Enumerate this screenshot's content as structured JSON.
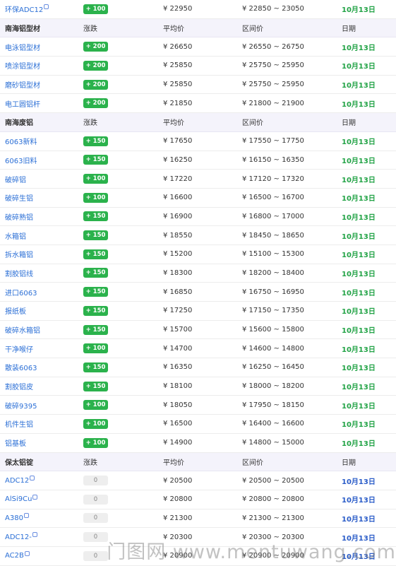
{
  "sections": [
    {
      "header": null,
      "rows": [
        {
          "name": "环保ADC12",
          "tag": true,
          "change": "+ 100",
          "change_type": "up",
          "avg": "¥ 22950",
          "range": "¥ 22850 ~ 23050",
          "date": "10月13日",
          "date_color": "green"
        }
      ]
    },
    {
      "header": {
        "name": "南海铝型材",
        "change": "涨跌",
        "avg": "平均价",
        "range": "区间价",
        "date": "日期"
      },
      "rows": [
        {
          "name": "电泳铝型材",
          "change": "+ 200",
          "change_type": "up",
          "avg": "¥ 26650",
          "range": "¥ 26550 ~ 26750",
          "date": "10月13日",
          "date_color": "green"
        },
        {
          "name": "喷涂铝型材",
          "change": "+ 200",
          "change_type": "up",
          "avg": "¥ 25850",
          "range": "¥ 25750 ~ 25950",
          "date": "10月13日",
          "date_color": "green"
        },
        {
          "name": "磨砂铝型材",
          "change": "+ 200",
          "change_type": "up",
          "avg": "¥ 25850",
          "range": "¥ 25750 ~ 25950",
          "date": "10月13日",
          "date_color": "green"
        },
        {
          "name": "电工圆铝杆",
          "change": "+ 200",
          "change_type": "up",
          "avg": "¥ 21850",
          "range": "¥ 21800 ~ 21900",
          "date": "10月13日",
          "date_color": "green"
        }
      ]
    },
    {
      "header": {
        "name": "南海废铝",
        "change": "涨跌",
        "avg": "平均价",
        "range": "区间价",
        "date": "日期"
      },
      "rows": [
        {
          "name": "6063新料",
          "change": "+ 150",
          "change_type": "up",
          "avg": "¥ 17650",
          "range": "¥ 17550 ~ 17750",
          "date": "10月13日",
          "date_color": "green"
        },
        {
          "name": "6063旧料",
          "change": "+ 150",
          "change_type": "up",
          "avg": "¥ 16250",
          "range": "¥ 16150 ~ 16350",
          "date": "10月13日",
          "date_color": "green"
        },
        {
          "name": "破碎铝",
          "change": "+ 100",
          "change_type": "up",
          "avg": "¥ 17220",
          "range": "¥ 17120 ~ 17320",
          "date": "10月13日",
          "date_color": "green"
        },
        {
          "name": "破碎生铝",
          "change": "+ 100",
          "change_type": "up",
          "avg": "¥ 16600",
          "range": "¥ 16500 ~ 16700",
          "date": "10月13日",
          "date_color": "green"
        },
        {
          "name": "破碎熟铝",
          "change": "+ 150",
          "change_type": "up",
          "avg": "¥ 16900",
          "range": "¥ 16800 ~ 17000",
          "date": "10月13日",
          "date_color": "green"
        },
        {
          "name": "水箱铝",
          "change": "+ 150",
          "change_type": "up",
          "avg": "¥ 18550",
          "range": "¥ 18450 ~ 18650",
          "date": "10月13日",
          "date_color": "green"
        },
        {
          "name": "拆水箱铝",
          "change": "+ 150",
          "change_type": "up",
          "avg": "¥ 15200",
          "range": "¥ 15100 ~ 15300",
          "date": "10月13日",
          "date_color": "green"
        },
        {
          "name": "割胶铝线",
          "change": "+ 150",
          "change_type": "up",
          "avg": "¥ 18300",
          "range": "¥ 18200 ~ 18400",
          "date": "10月13日",
          "date_color": "green"
        },
        {
          "name": "进口6063",
          "change": "+ 150",
          "change_type": "up",
          "avg": "¥ 16850",
          "range": "¥ 16750 ~ 16950",
          "date": "10月13日",
          "date_color": "green"
        },
        {
          "name": "报纸板",
          "change": "+ 150",
          "change_type": "up",
          "avg": "¥ 17250",
          "range": "¥ 17150 ~ 17350",
          "date": "10月13日",
          "date_color": "green"
        },
        {
          "name": "破碎水箱铝",
          "change": "+ 150",
          "change_type": "up",
          "avg": "¥ 15700",
          "range": "¥ 15600 ~ 15800",
          "date": "10月13日",
          "date_color": "green"
        },
        {
          "name": "干净喉仔",
          "change": "+ 100",
          "change_type": "up",
          "avg": "¥ 14700",
          "range": "¥ 14600 ~ 14800",
          "date": "10月13日",
          "date_color": "green"
        },
        {
          "name": "散装6063",
          "change": "+ 150",
          "change_type": "up",
          "avg": "¥ 16350",
          "range": "¥ 16250 ~ 16450",
          "date": "10月13日",
          "date_color": "green"
        },
        {
          "name": "割胶铝皮",
          "change": "+ 150",
          "change_type": "up",
          "avg": "¥ 18100",
          "range": "¥ 18000 ~ 18200",
          "date": "10月13日",
          "date_color": "green"
        },
        {
          "name": "破碎9395",
          "change": "+ 100",
          "change_type": "up",
          "avg": "¥ 18050",
          "range": "¥ 17950 ~ 18150",
          "date": "10月13日",
          "date_color": "green"
        },
        {
          "name": "机件生铝",
          "change": "+ 100",
          "change_type": "up",
          "avg": "¥ 16500",
          "range": "¥ 16400 ~ 16600",
          "date": "10月13日",
          "date_color": "green"
        },
        {
          "name": "铝基板",
          "change": "+ 100",
          "change_type": "up",
          "avg": "¥ 14900",
          "range": "¥ 14800 ~ 15000",
          "date": "10月13日",
          "date_color": "green"
        }
      ]
    },
    {
      "header": {
        "name": "保太铝锭",
        "change": "涨跌",
        "avg": "平均价",
        "range": "区间价",
        "date": "日期"
      },
      "rows": [
        {
          "name": "ADC12",
          "tag": true,
          "change": "0",
          "change_type": "flat",
          "avg": "¥ 20500",
          "range": "¥ 20500 ~ 20500",
          "date": "10月13日",
          "date_color": "blue"
        },
        {
          "name": "AlSi9Cu",
          "tag": true,
          "change": "0",
          "change_type": "flat",
          "avg": "¥ 20800",
          "range": "¥ 20800 ~ 20800",
          "date": "10月13日",
          "date_color": "blue"
        },
        {
          "name": "A380",
          "tag": true,
          "change": "0",
          "change_type": "flat",
          "avg": "¥ 21300",
          "range": "¥ 21300 ~ 21300",
          "date": "10月13日",
          "date_color": "blue"
        },
        {
          "name": "ADC12-",
          "tag": true,
          "change": "0",
          "change_type": "flat",
          "avg": "¥ 20300",
          "range": "¥ 20300 ~ 20300",
          "date": "10月13日",
          "date_color": "blue"
        },
        {
          "name": "AC2B",
          "tag": true,
          "change": "0",
          "change_type": "flat",
          "avg": "¥ 20900",
          "range": "¥ 20900 ~ 20900",
          "date": "10月13日",
          "date_color": "blue"
        }
      ]
    }
  ],
  "watermark": "门图网 www.mentuwang.com"
}
